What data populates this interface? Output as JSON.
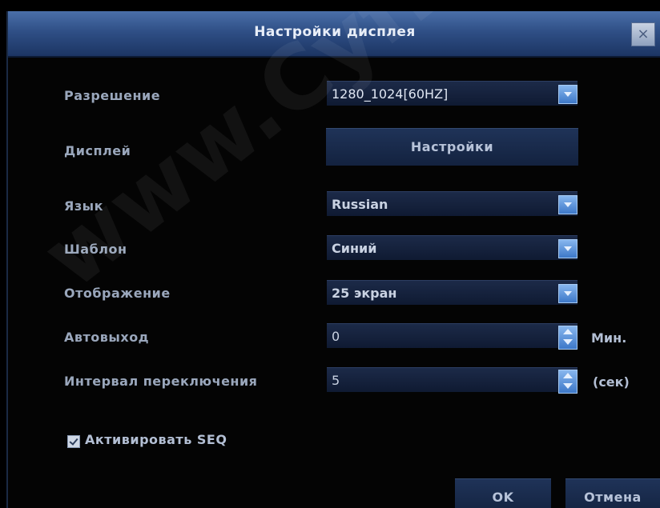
{
  "dialog": {
    "title": "Настройки дисплея",
    "close_symbol": "×"
  },
  "settings": {
    "resolution": {
      "label": "Разрешение",
      "value": "1280_1024[60HZ]"
    },
    "display": {
      "label": "Дисплей",
      "button": "Настройки"
    },
    "language": {
      "label": "Язык",
      "value": "Russian"
    },
    "template": {
      "label": "Шаблон",
      "value": "Синий"
    },
    "view": {
      "label": "Отображение",
      "value": "25 экран"
    },
    "autoexit": {
      "label": "Автовыход",
      "value": "0",
      "unit": "Мин."
    },
    "interval": {
      "label": "Интервал переключения",
      "value": "5",
      "unit": "(сек)"
    },
    "seq": {
      "label": "Активировать SEQ",
      "checked": true
    }
  },
  "buttons": {
    "ok": "OK",
    "cancel": "Отмена"
  },
  "watermark": "www.Cyfron.ru",
  "colors": {
    "titlebar": "#2f4f86",
    "accent": "#4a86d6",
    "background": "#040404"
  }
}
